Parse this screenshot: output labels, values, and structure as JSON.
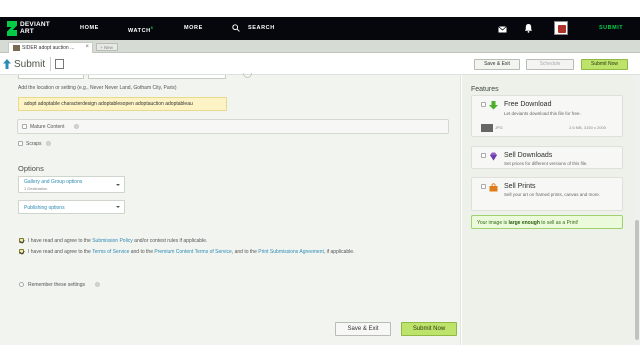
{
  "topbar": {
    "logo_text": "DEVIANT ART",
    "nav": {
      "home": "HOME",
      "watch": "WATCH",
      "watch_badge": "6",
      "more": "MORE",
      "search": "SEARCH"
    },
    "submit": "SUBMIT"
  },
  "tabs": {
    "active": "SIDER adopt auction ...",
    "close": "×",
    "new_tab": "+ New"
  },
  "toolbar": {
    "title": "Submit",
    "save_exit": "Save & Exit",
    "schedule": "Schedule",
    "submit_now": "Submit Now"
  },
  "form": {
    "location_label": "Add the location or setting (e.g., Never Never Land, Gotham City, Paris)",
    "tags": "adopt adoptable characterdesign adoptablesopen adoptauction adoptableau",
    "mature_label": "Mature Content",
    "scraps_label": "Scraps",
    "options_heading": "Options",
    "gallery_label": "Gallery and Group options",
    "gallery_sub": "1 Destination",
    "publishing_label": "Publishing options",
    "agree1": {
      "pre": "I have read and agree to the ",
      "link1": "Submission Policy",
      "post": " and/or contest rules if applicable."
    },
    "agree2": {
      "pre": "I have read and agree to the ",
      "link1": "Terms of Service",
      "mid1": " and to the ",
      "link2": "Premium Content Terms of Service",
      "mid2": ", and to the ",
      "link3": "Print Submissions Agreement",
      "post": ", if applicable."
    },
    "remember": "Remember these settings",
    "save_exit": "Save & Exit",
    "submit_now": "Submit Now"
  },
  "features": {
    "heading": "Features",
    "download": {
      "title": "Free Download",
      "desc": "Let deviants download this file for free.",
      "file_type": "JPG",
      "file_info": "2.6 MB, 3150 x 2000"
    },
    "sell_downloads": {
      "title": "Sell Downloads",
      "desc": "Set prices for different versions of this file."
    },
    "sell_prints": {
      "title": "Sell Prints",
      "desc": "Sell your art on framed prints, canvas and more."
    },
    "print_note": {
      "pre": "Your image is ",
      "bold": "large enough",
      "post": " to sell as a Print!"
    }
  },
  "colors": {
    "brand_green": "#05cc47",
    "topbar": "#06070d",
    "submit_btn": "#bde36a",
    "link": "#2e8bb5",
    "tag_bg": "#fdf3c4"
  }
}
